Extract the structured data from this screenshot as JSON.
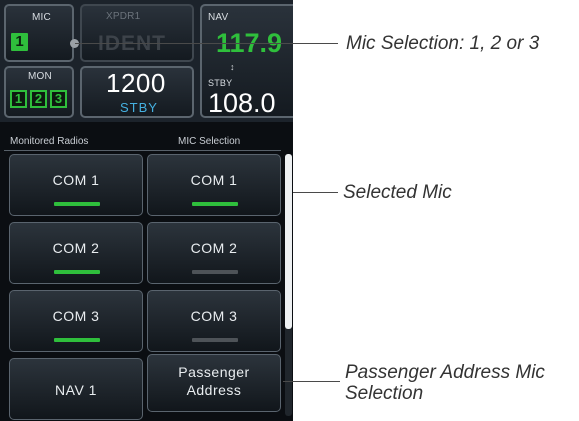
{
  "top": {
    "mic_label": "MIC",
    "mic_value": "1",
    "mon_label": "MON",
    "mon_values": [
      "1",
      "2",
      "3"
    ],
    "xpdr_label": "XPDR1",
    "ident_label": "IDENT",
    "squawk_code": "1200",
    "squawk_mode": "STBY",
    "nav_label": "NAV",
    "nav_active": "117.9",
    "stby_label": "STBY",
    "nav_standby": "108.0"
  },
  "headers": {
    "monitored": "Monitored Radios",
    "mic_selection": "MIC Selection"
  },
  "monitored_radios": [
    {
      "label": "COM 1",
      "active": true
    },
    {
      "label": "COM 2",
      "active": false
    },
    {
      "label": "COM 3",
      "active": true
    },
    {
      "label": "NAV 1",
      "active": false
    }
  ],
  "mic_selection": [
    {
      "label": "COM 1",
      "active": true
    },
    {
      "label": "COM 2",
      "active": false
    },
    {
      "label": "COM 3",
      "active": false
    }
  ],
  "passenger_address": {
    "line1": "Passenger",
    "line2": "Address"
  },
  "callouts": {
    "mic": "Mic Selection: 1, 2 or 3",
    "selected": "Selected Mic",
    "pa_line1": "Passenger Address Mic",
    "pa_line2": "Selection"
  },
  "colors": {
    "active_indicator": "#2fbf3c",
    "inactive_indicator": "#4e5358",
    "squawk_mode": "#45b0e0"
  }
}
